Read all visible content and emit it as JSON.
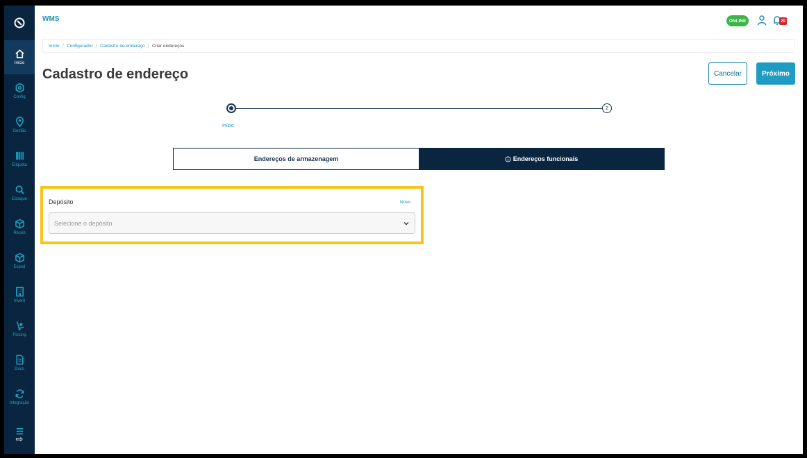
{
  "app": {
    "title": "WMS",
    "status": "ONLINE",
    "notification_count": "20"
  },
  "sidebar": {
    "items": [
      {
        "label": "Início",
        "icon": "home-icon"
      },
      {
        "label": "Config",
        "icon": "gear-icon"
      },
      {
        "label": "Gestão",
        "icon": "location-pin-icon"
      },
      {
        "label": "Etiqueta",
        "icon": "barcode-icon"
      },
      {
        "label": "Estoque",
        "icon": "search-icon"
      },
      {
        "label": "Receb",
        "icon": "box-in-icon"
      },
      {
        "label": "Exped",
        "icon": "box-out-icon"
      },
      {
        "label": "Invent",
        "icon": "building-icon"
      },
      {
        "label": "Picking",
        "icon": "hand-truck-icon"
      },
      {
        "label": "Docs",
        "icon": "document-icon"
      },
      {
        "label": "Integração",
        "icon": "sync-icon"
      },
      {
        "label": "",
        "icon": "list-icon"
      }
    ]
  },
  "breadcrumb": [
    "Início",
    "Configurador",
    "Cadastro de endereço",
    "Criar endereços"
  ],
  "page": {
    "title": "Cadastro de endereço",
    "cancel": "Cancelar",
    "next": "Próximo"
  },
  "stepper": {
    "step1_label": "Início",
    "step2_number": "2"
  },
  "tabs": {
    "storage": "Endereços de armazenagem",
    "functional": "Endereços funcionais"
  },
  "deposit": {
    "label": "Depósito",
    "new_link": "Novo",
    "placeholder": "Selecione o depósito"
  },
  "colors": {
    "sidebar": "#0a2540",
    "accent": "#1f9cc4",
    "highlight": "#f5c51c",
    "online": "#3bb54a"
  }
}
